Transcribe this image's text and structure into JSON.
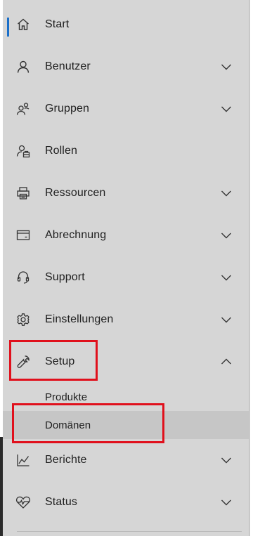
{
  "nav": {
    "items": [
      {
        "label": "Start",
        "icon": "home-icon",
        "chevron": "none",
        "active": true
      },
      {
        "label": "Benutzer",
        "icon": "user-icon",
        "chevron": "down"
      },
      {
        "label": "Gruppen",
        "icon": "group-icon",
        "chevron": "down"
      },
      {
        "label": "Rollen",
        "icon": "role-icon",
        "chevron": "none"
      },
      {
        "label": "Ressourcen",
        "icon": "printer-icon",
        "chevron": "down"
      },
      {
        "label": "Abrechnung",
        "icon": "credit-card-icon",
        "chevron": "down"
      },
      {
        "label": "Support",
        "icon": "headset-icon",
        "chevron": "down"
      },
      {
        "label": "Einstellungen",
        "icon": "gear-icon",
        "chevron": "down"
      },
      {
        "label": "Setup",
        "icon": "wrench-icon",
        "chevron": "up",
        "expanded": true
      },
      {
        "label": "Berichte",
        "icon": "line-chart-icon",
        "chevron": "down"
      },
      {
        "label": "Status",
        "icon": "heart-pulse-icon",
        "chevron": "down"
      }
    ],
    "setup_subitems": [
      {
        "label": "Produkte",
        "selected": false
      },
      {
        "label": "Domänen",
        "selected": true
      }
    ]
  },
  "colors": {
    "background": "#d6d6d6",
    "active_indicator": "#1a6fc9",
    "highlight_box": "#e0101c",
    "selected_row": "#c6c6c6"
  }
}
